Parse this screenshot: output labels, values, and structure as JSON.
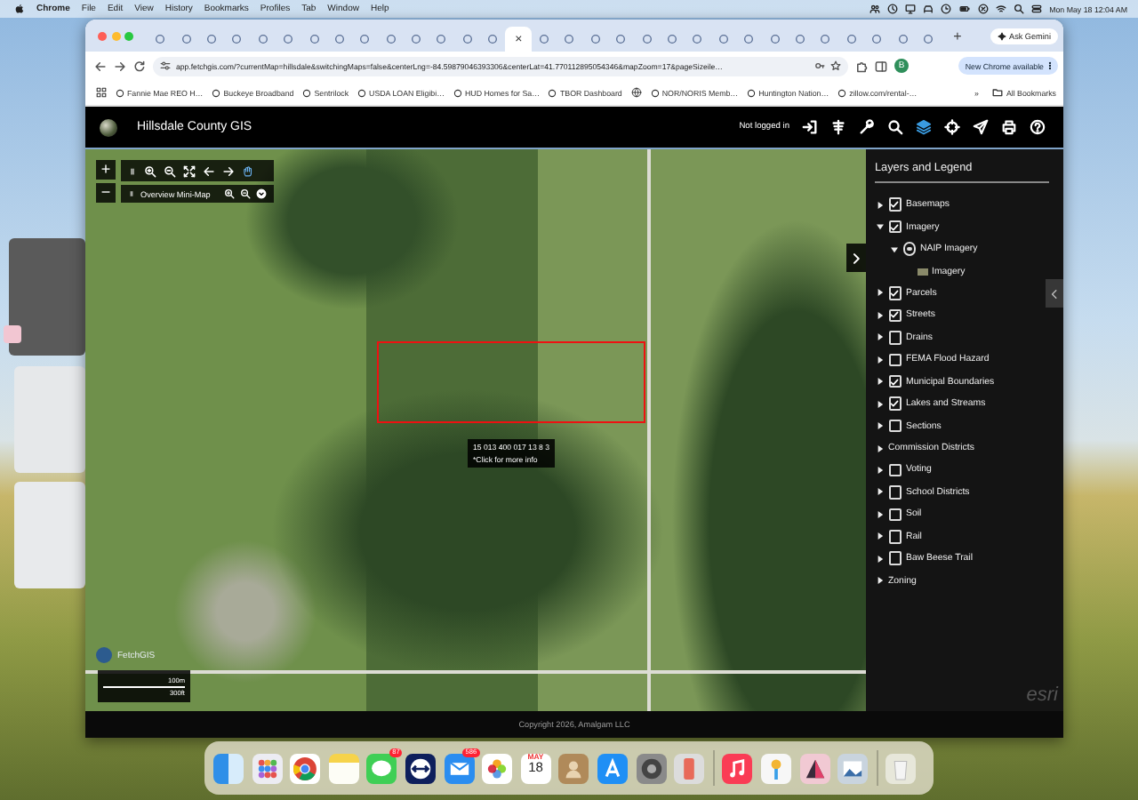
{
  "menu_bar": {
    "app": "Chrome",
    "items": [
      "File",
      "Edit",
      "View",
      "History",
      "Bookmarks",
      "Profiles",
      "Tab",
      "Window",
      "Help"
    ],
    "clock": "Mon May 18  12:04 AM"
  },
  "browser": {
    "tabs": [
      {
        "selected": false
      },
      {
        "selected": false
      },
      {
        "selected": false
      },
      {
        "selected": false
      },
      {
        "selected": false
      },
      {
        "selected": false
      },
      {
        "selected": false
      },
      {
        "selected": false
      },
      {
        "selected": false
      },
      {
        "selected": false
      },
      {
        "selected": false
      },
      {
        "selected": false
      },
      {
        "selected": false
      },
      {
        "selected": false
      },
      {
        "selected": true
      },
      {
        "selected": false
      },
      {
        "selected": false
      },
      {
        "selected": false
      },
      {
        "selected": false
      },
      {
        "selected": false
      },
      {
        "selected": false
      },
      {
        "selected": false
      },
      {
        "selected": false
      },
      {
        "selected": false
      },
      {
        "selected": false
      },
      {
        "selected": false
      },
      {
        "selected": false
      },
      {
        "selected": false
      },
      {
        "selected": false
      },
      {
        "selected": false
      },
      {
        "selected": false
      }
    ],
    "tab_close": "×",
    "new_tab": "+",
    "ask_gemini": "Ask Gemini",
    "url": "app.fetchgis.com/?currentMap=hillsdale&switchingMaps=false&centerLng=-84.59879046393306&centerLat=41.770112895054346&mapZoom=17&pageSizeile…",
    "profile_initial": "B",
    "update_button": "New Chrome available",
    "bookmarks": [
      {
        "kind": "link",
        "label": "Fannie Mae REO H…"
      },
      {
        "kind": "link",
        "label": "Buckeye Broadband"
      },
      {
        "kind": "link",
        "label": "Sentrilock"
      },
      {
        "kind": "link",
        "label": "USDA LOAN Eligibi…"
      },
      {
        "kind": "link",
        "label": "HUD Homes for Sa…"
      },
      {
        "kind": "link",
        "label": "TBOR Dashboard"
      },
      {
        "kind": "icon"
      },
      {
        "kind": "link",
        "label": "NOR/NORIS Memb…"
      },
      {
        "kind": "link",
        "label": "Huntington Nation…"
      },
      {
        "kind": "link",
        "label": "zillow.com/rental-…"
      }
    ],
    "more_bookmarks": "»",
    "all_bookmarks": "All Bookmarks"
  },
  "gis": {
    "title": "Hillsdale County GIS",
    "login_status": "Not logged in",
    "zoom_in": "+",
    "zoom_out": "−",
    "minimap_label": "Overview Mini-Map",
    "popup": {
      "parcel_id": "15 013 400 017 13 8 3",
      "hint": "*Click for more info"
    },
    "attribution": "FetchGIS",
    "scale": {
      "metric": "100m",
      "imperial": "300ft"
    },
    "esri": "esri",
    "layers_panel": {
      "title": "Layers and Legend",
      "layers": [
        {
          "kind": "checkbox",
          "label": "Basemaps",
          "checked": true,
          "expanded": false
        },
        {
          "kind": "checkbox",
          "label": "Imagery",
          "checked": true,
          "expanded": true,
          "children": [
            {
              "kind": "radio",
              "label": "NAIP Imagery",
              "selected": true,
              "expanded": true,
              "children": [
                {
                  "kind": "legend",
                  "label": "Imagery"
                }
              ]
            }
          ]
        },
        {
          "kind": "checkbox",
          "label": "Parcels",
          "checked": true,
          "expanded": false
        },
        {
          "kind": "checkbox",
          "label": "Streets",
          "checked": true,
          "expanded": false
        },
        {
          "kind": "checkbox",
          "label": "Drains",
          "checked": false,
          "expanded": false
        },
        {
          "kind": "checkbox",
          "label": "FEMA Flood Hazard",
          "checked": false,
          "expanded": false
        },
        {
          "kind": "checkbox",
          "label": "Municipal Boundaries",
          "checked": true,
          "expanded": false
        },
        {
          "kind": "checkbox",
          "label": "Lakes and Streams",
          "checked": true,
          "expanded": false
        },
        {
          "kind": "checkbox",
          "label": "Sections",
          "checked": false,
          "expanded": false
        },
        {
          "kind": "group",
          "label": "Commission Districts",
          "expanded": false
        },
        {
          "kind": "checkbox",
          "label": "Voting",
          "checked": false,
          "expanded": false
        },
        {
          "kind": "checkbox",
          "label": "School Districts",
          "checked": false,
          "expanded": false
        },
        {
          "kind": "checkbox",
          "label": "Soil",
          "checked": false,
          "expanded": false
        },
        {
          "kind": "checkbox",
          "label": "Rail",
          "checked": false,
          "expanded": false
        },
        {
          "kind": "checkbox",
          "label": "Baw Beese Trail",
          "checked": false,
          "expanded": false
        },
        {
          "kind": "group",
          "label": "Zoning",
          "expanded": false
        }
      ]
    },
    "footer": "Copyright 2026, Amalgam LLC"
  },
  "dock": {
    "apps": [
      {
        "kind": "finder"
      },
      {
        "kind": "launchpad"
      },
      {
        "kind": "chrome"
      },
      {
        "kind": "notes"
      },
      {
        "kind": "messages",
        "badge": "87"
      },
      {
        "kind": "remote"
      },
      {
        "kind": "mail",
        "badge": "586"
      },
      {
        "kind": "photos"
      },
      {
        "kind": "calendar",
        "month": "MAY",
        "day": "18"
      },
      {
        "kind": "contacts"
      },
      {
        "kind": "appstore"
      },
      {
        "kind": "settings"
      },
      {
        "kind": "mirroring"
      },
      {
        "kind": "divider"
      },
      {
        "kind": "music"
      },
      {
        "kind": "passwords"
      },
      {
        "kind": "designer"
      },
      {
        "kind": "preview"
      },
      {
        "kind": "divider"
      },
      {
        "kind": "trash"
      }
    ]
  }
}
